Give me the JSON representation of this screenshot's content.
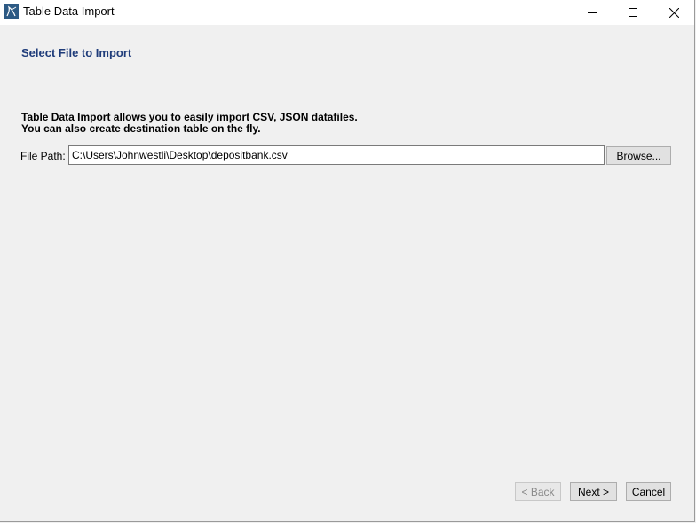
{
  "window": {
    "title": "Table Data Import",
    "icon": "mysql-workbench-icon"
  },
  "page": {
    "title": "Select File to Import",
    "description_line1": "Table Data Import allows you to easily import CSV, JSON datafiles.",
    "description_line2": "You can also create destination table on the fly."
  },
  "file_path": {
    "label": "File Path:",
    "value": "C:\\Users\\Johnwestli\\Desktop\\depositbank.csv",
    "browse_label": "Browse..."
  },
  "footer": {
    "back_label": "< Back",
    "next_label": "Next >",
    "cancel_label": "Cancel"
  },
  "colors": {
    "title_color": "#1f3c7a",
    "window_bg": "#f0f0f0",
    "titlebar_bg": "#ffffff"
  }
}
